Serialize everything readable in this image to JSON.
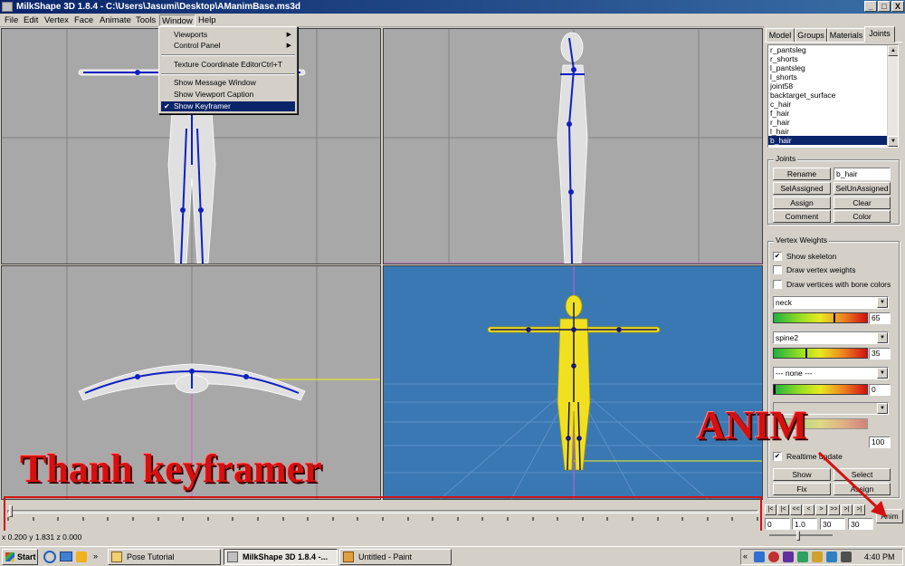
{
  "window": {
    "title": "MilkShape 3D 1.8.4 - C:\\Users\\Jasumi\\Desktop\\AManimBase.ms3d",
    "minimize": "_",
    "maximize": "□",
    "close": "X"
  },
  "menubar": {
    "items": [
      "File",
      "Edit",
      "Vertex",
      "Face",
      "Animate",
      "Tools",
      "Window",
      "Help"
    ],
    "open_menu": "Window"
  },
  "window_menu": {
    "items": [
      {
        "label": "Viewports",
        "shortcut": "",
        "submenu": "▶",
        "checked": ""
      },
      {
        "label": "Control Panel",
        "shortcut": "",
        "submenu": "▶",
        "checked": ""
      },
      {
        "label": "Texture Coordinate Editor",
        "shortcut": "Ctrl+T",
        "submenu": "",
        "checked": ""
      },
      {
        "label": "Show Message Window",
        "shortcut": "",
        "submenu": "",
        "checked": ""
      },
      {
        "label": "Show Viewport Caption",
        "shortcut": "",
        "submenu": "",
        "checked": ""
      },
      {
        "label": "Show Keyframer",
        "shortcut": "",
        "submenu": "",
        "checked": "✔"
      }
    ]
  },
  "panel": {
    "tabs": [
      "Model",
      "Groups",
      "Materials",
      "Joints"
    ],
    "active_tab": "Joints",
    "joints_list": [
      "r_pantsleg",
      "r_shorts",
      "l_pantsleg",
      "l_shorts",
      "joint58",
      "backtarget_surface",
      "c_hair",
      "f_hair",
      "r_hair",
      "l_hair",
      "b_hair"
    ],
    "selected_joint": "b_hair",
    "joints_group": {
      "title": "Joints",
      "rename": "Rename",
      "name_value": "b_hair",
      "sel_assigned": "SelAssigned",
      "sel_unassigned": "SelUnAssigned",
      "assign": "Assign",
      "clear": "Clear",
      "comment": "Comment",
      "color": "Color"
    },
    "vertex_weights": {
      "title": "Vertex Weights",
      "show_skeleton": "Show skeleton",
      "show_skeleton_checked": "✔",
      "draw_vertex_weights": "Draw vertex weights",
      "draw_vertices_bone_colors": "Draw vertices with bone colors",
      "bones": [
        {
          "name": "neck",
          "weight": "65",
          "fraction": 0.65
        },
        {
          "name": "spine2",
          "weight": "35",
          "fraction": 0.35
        },
        {
          "name": "--- none ---",
          "weight": "0",
          "fraction": 0.0
        }
      ],
      "hidden_value": "100",
      "realtime_update": "Realtime update",
      "realtime_update_checked": "✔",
      "show": "Show",
      "select": "Select",
      "fix": "Fix",
      "assign": "Assign"
    }
  },
  "keyframer": {
    "fields": [
      "0",
      "1.0",
      "30",
      "30"
    ],
    "anim_button": "Anim",
    "buttons": [
      "|<",
      "|<",
      "<<",
      "<",
      ">",
      ">>",
      ">|",
      ">|"
    ]
  },
  "status": {
    "coords": "x 0.200 y 1.831 z 0.000"
  },
  "annotations": {
    "keyframer_label": "Thanh keyframer",
    "anim_label": "ANIM"
  },
  "taskbar": {
    "start": "Start",
    "tasks": [
      {
        "label": "Pose Tutorial",
        "active": false
      },
      {
        "label": "MilkShape 3D 1.8.4 -...",
        "active": true
      },
      {
        "label": "Untitled - Paint",
        "active": false
      }
    ],
    "clock": "4:40 PM"
  },
  "colors": {
    "title_gradient_start": "#0a246a",
    "selection": "#0a246a",
    "viewport_gray": "#a8a8a8",
    "viewport_blue": "#3a78b4",
    "bone": "#1020c0",
    "model_yellow": "#f0e020",
    "annotation_red": "#d41010"
  }
}
